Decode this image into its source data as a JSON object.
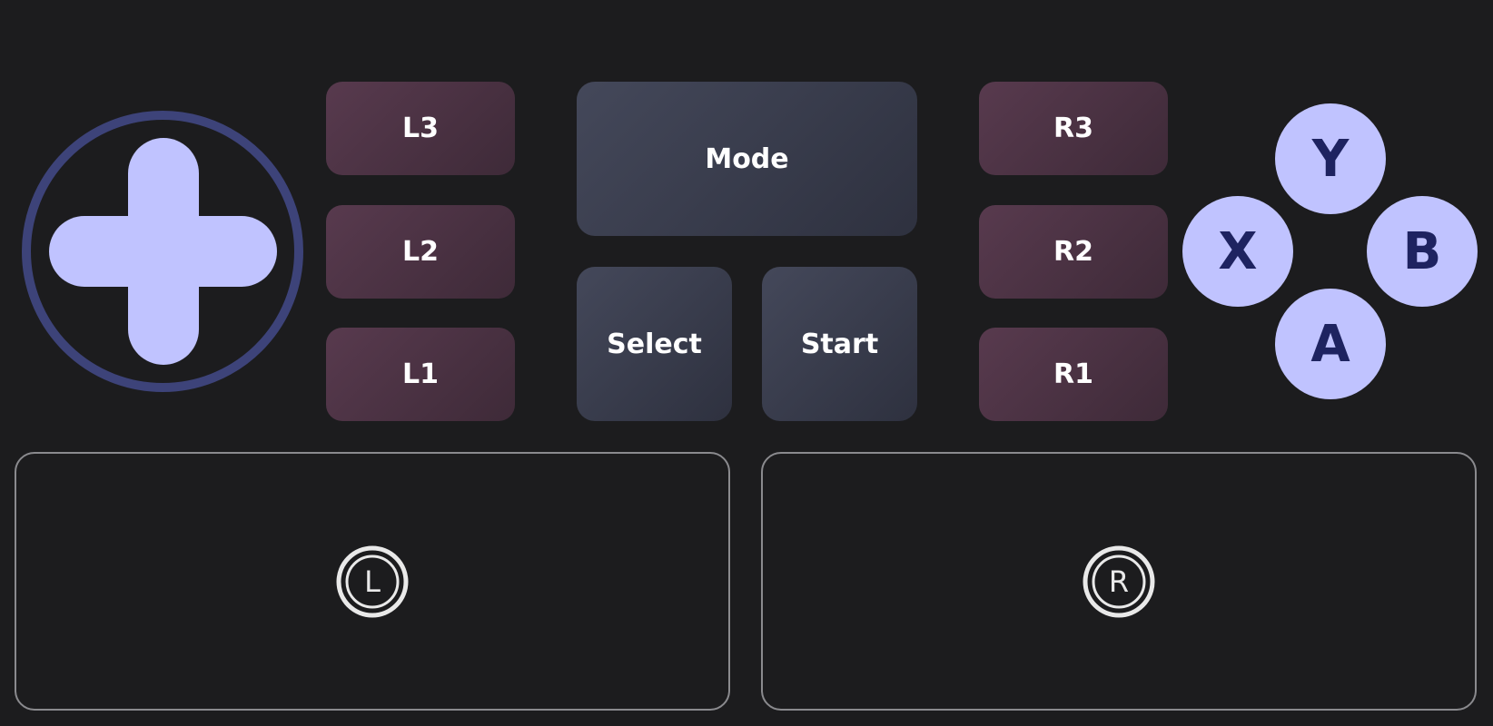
{
  "dpad": {
    "name": "dpad",
    "colors": {
      "ring": "#3d4379",
      "cross": "#c0c3ff"
    }
  },
  "shoulders": {
    "left": [
      "L3",
      "L2",
      "L1"
    ],
    "right": [
      "R3",
      "R2",
      "R1"
    ]
  },
  "system": {
    "mode_label": "Mode",
    "select_label": "Select",
    "start_label": "Start"
  },
  "face_buttons": {
    "y": "Y",
    "x": "X",
    "b": "B",
    "a": "A"
  },
  "sticks": {
    "left_label": "L",
    "right_label": "R"
  },
  "colors": {
    "background": "#1c1c1e",
    "shoulder_start": "#583a4e",
    "shoulder_end": "#3e2a38",
    "system_start": "#44485a",
    "system_end": "#2e313f",
    "face_fill": "#c0c3ff",
    "face_text": "#1e2360",
    "stick_border": "#8a8a8e",
    "stick_icon": "#e9e9e9"
  }
}
